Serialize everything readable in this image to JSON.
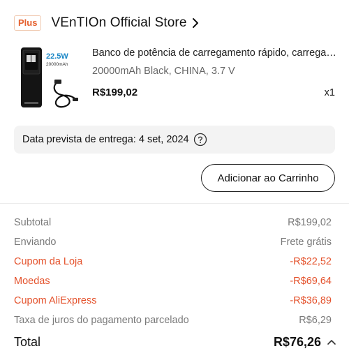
{
  "store": {
    "badge": "Plus",
    "name": "VEnTIOn Official Store"
  },
  "product": {
    "title": "Banco de potência de carregamento rápido, carregador portátil",
    "variant": "20000mAh Black, CHINA, 3.7 V",
    "price": "R$199,02",
    "quantity": "x1",
    "image_text": {
      "power": "22.5W",
      "capacity": "20000mAh"
    }
  },
  "delivery": {
    "text": "Data prevista de entrega: 4 set, 2024"
  },
  "actions": {
    "add_to_cart": "Adicionar ao Carrinho"
  },
  "summary": {
    "rows": [
      {
        "label": "Subtotal",
        "value": "R$199,02",
        "type": "normal"
      },
      {
        "label": "Enviando",
        "value": "Frete grátis",
        "type": "normal"
      },
      {
        "label": "Cupom da Loja",
        "value": "-R$22,52",
        "type": "discount"
      },
      {
        "label": "Moedas",
        "value": "-R$69,64",
        "type": "discount"
      },
      {
        "label": "Cupom AliExpress",
        "value": "-R$36,89",
        "type": "discount"
      },
      {
        "label": "Taxa de juros do pagamento parcelado",
        "value": "R$6,29",
        "type": "normal"
      }
    ],
    "total_label": "Total",
    "total_value": "R$76,26"
  },
  "colors": {
    "accent": "#e4522c",
    "muted": "#7a7a7a"
  }
}
